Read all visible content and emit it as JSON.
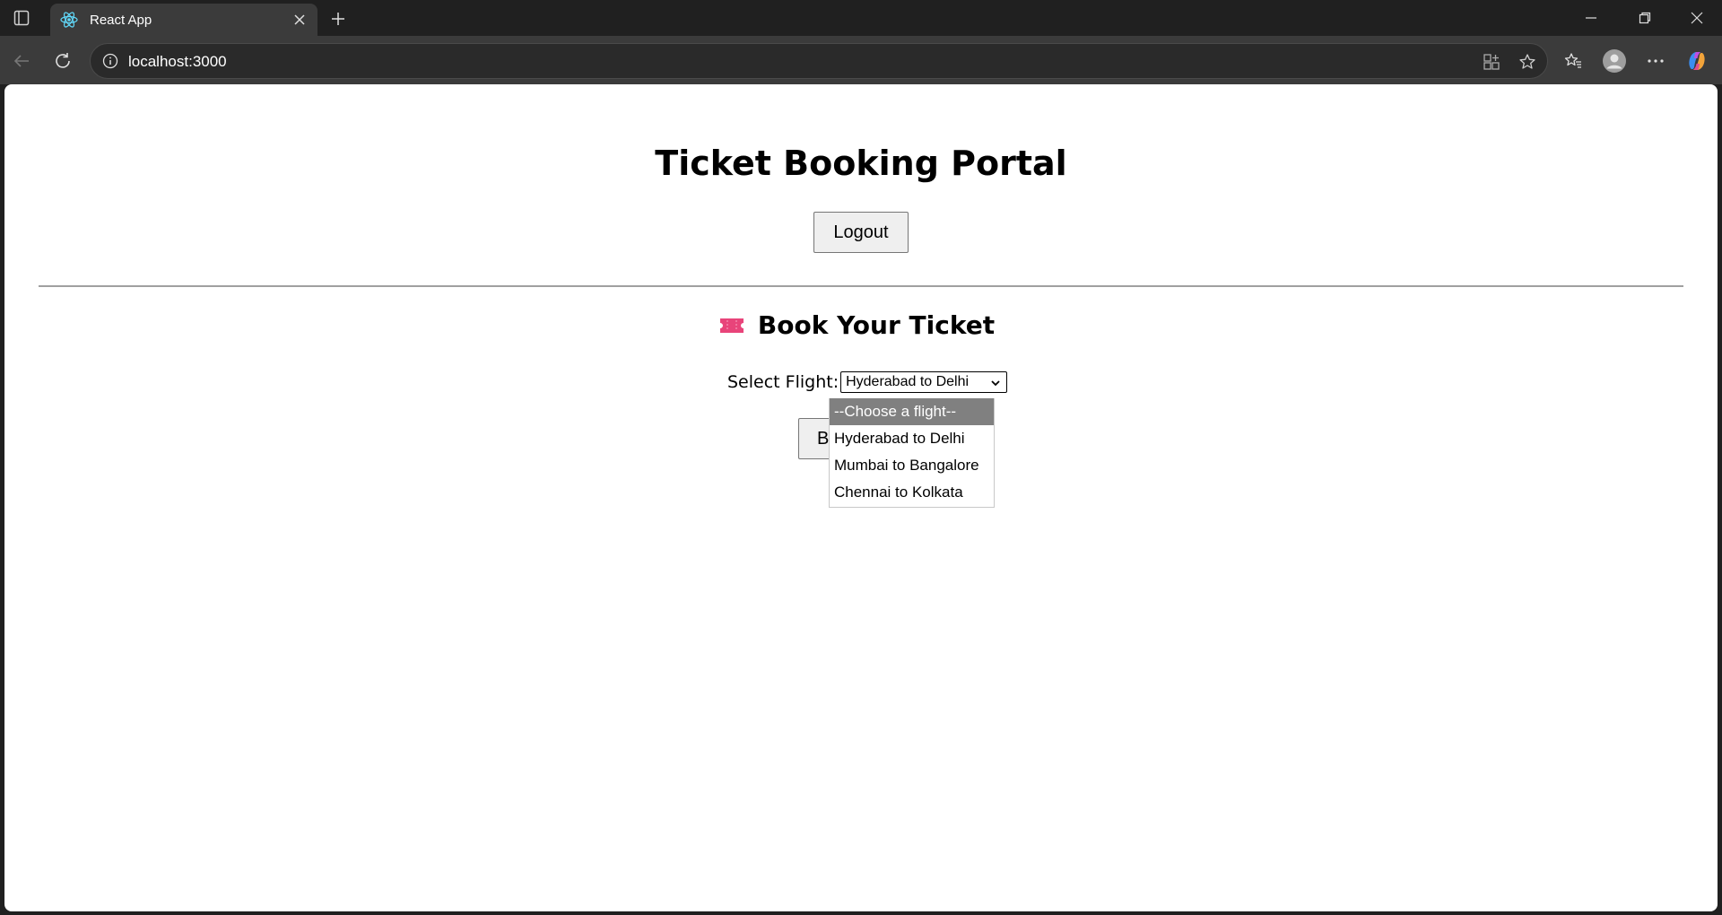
{
  "browser": {
    "tab_title": "React App",
    "url": "localhost:3000"
  },
  "page": {
    "title": "Ticket Booking Portal",
    "logout_label": "Logout",
    "section_heading": "Book Your Ticket",
    "flight_label": "Select Flight:",
    "selected_flight": "Hyderabad to Delhi",
    "book_button_label_visible": "B",
    "flight_options": [
      "--Choose a flight--",
      "Hyderabad to Delhi",
      "Mumbai to Bangalore",
      "Chennai to Kolkata"
    ]
  },
  "icons": {
    "section": "ticket-icon",
    "favicon": "react-icon"
  },
  "colors": {
    "chrome_dark": "#202020",
    "chrome_toolbar": "#3b3b3b",
    "ticket_pink": "#e8447a",
    "option_highlight": "#808080"
  }
}
